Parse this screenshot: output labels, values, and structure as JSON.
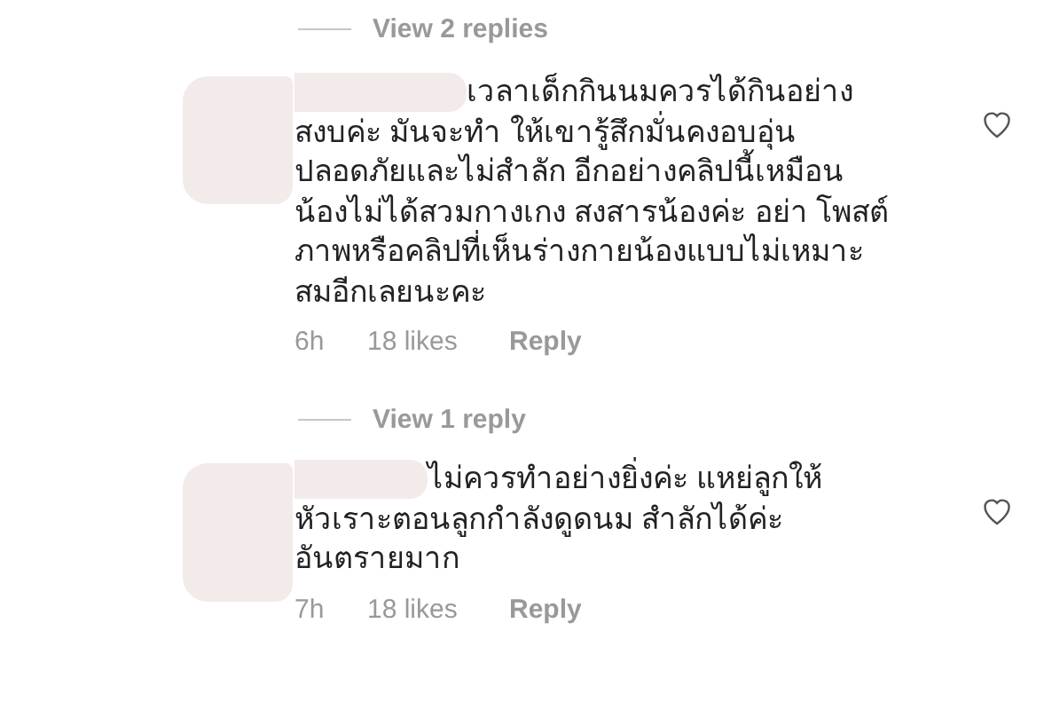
{
  "threads": [
    {
      "view_replies": "View 2 replies",
      "comment": {
        "lines": [
          "เวลาเด็กกินนมควรได้กินอย่าง",
          "สงบค่ะ มันจะทำ ให้เขารู้สึกมั่นคงอบอุ่น",
          "ปลอดภัยและไม่สำลัก อีกอย่างคลิปนี้เหมือน",
          "น้องไม่ได้สวมกางเกง สงสารน้องค่ะ อย่า โพสต์",
          "ภาพหรือคลิปที่เห็นร่างกายน้องแบบไม่เหมาะ",
          "สมอีกเลยนะคะ"
        ],
        "time": "6h",
        "likes": "18 likes",
        "reply": "Reply",
        "liked": false
      }
    },
    {
      "view_replies": "View 1 reply",
      "comment": {
        "lines": [
          "ไม่ควรทำอย่างยิ่งค่ะ แหย่ลูกให้",
          "หัวเราะตอนลูกกำลังดูดนม  สำลักได้ค่ะ",
          "อันตรายมาก"
        ],
        "time": "7h",
        "likes": "18 likes",
        "reply": "Reply",
        "liked": false
      }
    }
  ]
}
